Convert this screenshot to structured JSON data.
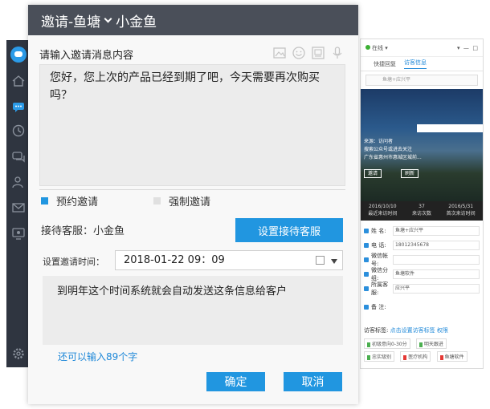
{
  "dialog": {
    "title": "邀请-鱼塘",
    "title_user": "小金鱼",
    "prompt_label": "请输入邀请消息内容",
    "message_text": "您好，您上次的产品已经到期了吧，今天需要再次购买吗？",
    "options": [
      {
        "label": "预约邀请",
        "selected": true
      },
      {
        "label": "强制邀请",
        "selected": false
      }
    ],
    "host_label": "接待客服：小金鱼",
    "set_host_button": "设置接待客服",
    "time_label": "设置邀请时间：",
    "time_value": "2018-01-22 09：09",
    "note_text": "到明年这个时间系统就会自动发送这条信息给客户",
    "remaining_text": "还可以输入89个字",
    "ok_button": "确定",
    "cancel_button": "取消",
    "tool_icons": [
      "image-icon",
      "emoji-icon",
      "screenshot-icon",
      "microphone-icon"
    ]
  },
  "sidebar": {
    "icons": [
      "home-icon",
      "chat-icon",
      "history-icon",
      "message-icon",
      "contacts-icon",
      "mail-icon",
      "monitor-icon",
      "settings-icon"
    ]
  },
  "info_panel": {
    "status": "在线",
    "tabs": [
      "快捷回复",
      "访客信息"
    ],
    "search_text": "鱼塘+应兴平",
    "photo_lines": [
      "来源：访问者",
      "搜索公众号或进去关注",
      "广东省惠州市惠城区城前..."
    ],
    "photo_buttons": [
      "邀请",
      "刷新"
    ],
    "stats": [
      {
        "value": "2016/10/10",
        "label": "最近来访时间"
      },
      {
        "value": "37",
        "label": "来访次数"
      },
      {
        "value": "2016/5/31",
        "label": "首次来访时间"
      }
    ],
    "fields": [
      {
        "label": "姓 名:",
        "value": "鱼塘+应兴平"
      },
      {
        "label": "电 话:",
        "value": "18012345678"
      },
      {
        "label": "微信帐号:",
        "value": ""
      },
      {
        "label": "微信分组:",
        "value": "鱼塘软件"
      },
      {
        "label": "所属客服:",
        "value": "应兴平"
      },
      {
        "label": "备 注:",
        "value": ""
      }
    ],
    "tags_title": "访客标签:",
    "tags_link": "点击设置访客标签",
    "tags_manage": "权限",
    "tags": [
      {
        "label": "初级意向0-30分",
        "color": "#4caf50"
      },
      {
        "label": "明天跟进",
        "color": "#4caf50"
      },
      {
        "label": "忠实级别",
        "color": "#4caf50"
      },
      {
        "label": "医疗机构",
        "color": "#e53935"
      },
      {
        "label": "鱼塘软件",
        "color": "#e53935"
      }
    ]
  },
  "colors": {
    "title_bar": "#4a4f59",
    "accent": "#2196e0",
    "sidebar": "#2f3540"
  }
}
